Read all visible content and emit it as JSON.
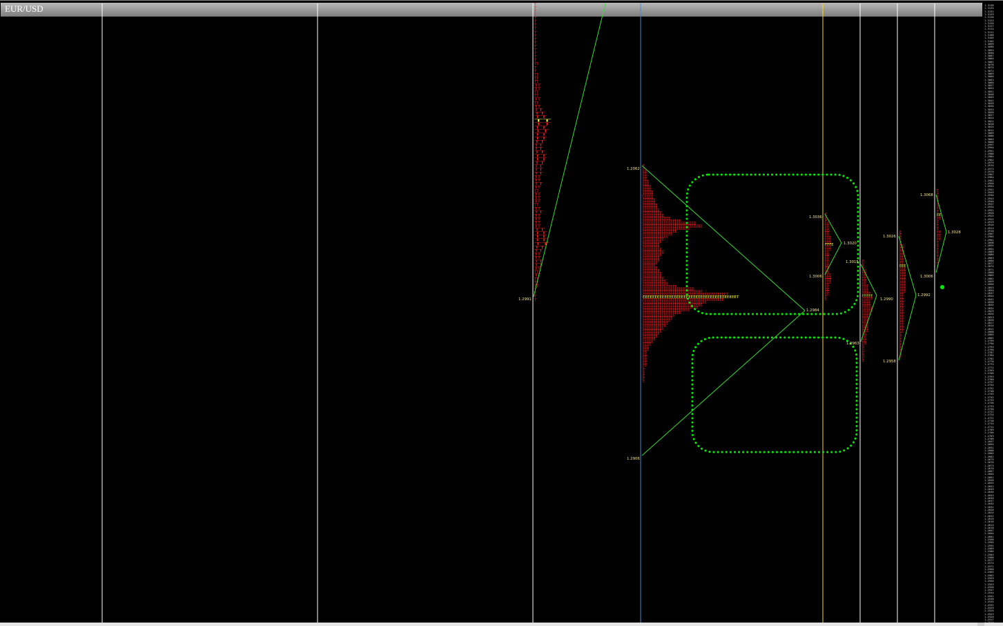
{
  "chart": {
    "symbol": "EUR/USD",
    "colors": {
      "background": "#000000",
      "session_divider": "#ffffff",
      "blue_marker": "#3c8ddc",
      "yellow_marker": "#ffd700",
      "tpo": "#ff1a1a",
      "poc": "#ffff33",
      "trend_line": "#33dd33",
      "highlight_box": "#00ee00",
      "level_label": "#f4e48a"
    }
  },
  "level_labels": [
    "1.2991",
    "1.2062",
    "1.2906",
    "1.2984",
    "1.3036",
    "1.3020",
    "1.3006",
    "1.3015",
    "1.2990",
    "1.2963",
    "1.3026",
    "1.3006",
    "1.2992",
    "1.2958",
    "1.3068",
    "1.3028"
  ],
  "price_scale": {
    "ticks": [
      "1.3138",
      "1.3135",
      "1.3132",
      "1.3129",
      "1.3126",
      "1.3123",
      "1.3120",
      "1.3117",
      "1.3114",
      "1.3111",
      "1.3108",
      "1.3105",
      "1.3102",
      "1.3099",
      "1.3096",
      "1.3093",
      "1.3090",
      "1.3087",
      "1.3084",
      "1.3081",
      "1.3078",
      "1.3075",
      "1.3072",
      "1.3069",
      "1.3066",
      "1.3063",
      "1.3060",
      "1.3057",
      "1.3054",
      "1.3051",
      "1.3048",
      "1.3045",
      "1.3042",
      "1.3039",
      "1.3036",
      "1.3033",
      "1.3030",
      "1.3027",
      "1.3024",
      "1.3021",
      "1.3018",
      "1.3015",
      "1.3012",
      "1.3009",
      "1.3006",
      "1.3003",
      "1.3000",
      "1.2997",
      "1.2994",
      "1.2991",
      "1.2988",
      "1.2985",
      "1.2982",
      "1.2979",
      "1.2976",
      "1.2973",
      "1.2970",
      "1.2967",
      "1.2964",
      "1.2961",
      "1.2958",
      "1.2955",
      "1.2952",
      "1.2949",
      "1.2946",
      "1.2943",
      "1.2940",
      "1.2937",
      "1.2934",
      "1.2931",
      "1.2928",
      "1.2925",
      "1.2922",
      "1.2919",
      "1.2916",
      "1.2913",
      "1.2910",
      "1.2907",
      "1.2904",
      "1.2901",
      "1.2898",
      "1.2895",
      "1.2892",
      "1.2889",
      "1.2886",
      "1.2883",
      "1.2880",
      "1.2877",
      "1.2874",
      "1.2871",
      "1.2868",
      "1.2865",
      "1.2862",
      "1.2859",
      "1.2856",
      "1.2853",
      "1.2850",
      "1.2847",
      "1.2844",
      "1.2841",
      "1.2838",
      "1.2835",
      "1.2832",
      "1.2829",
      "1.2826",
      "1.2823",
      "1.2820",
      "1.2817",
      "1.2814",
      "1.2811",
      "1.2808",
      "1.2805",
      "1.2802",
      "1.2799",
      "1.2796",
      "1.2793",
      "1.2790",
      "1.2787",
      "1.2784",
      "1.2781",
      "1.2778",
      "1.2775",
      "1.2772",
      "1.2769",
      "1.2766",
      "1.2763",
      "1.2760",
      "1.2757",
      "1.2754",
      "1.2751",
      "1.2748",
      "1.2745",
      "1.2742",
      "1.2739",
      "1.2736",
      "1.2733",
      "1.2730",
      "1.2727",
      "1.2724",
      "1.2721",
      "1.2718",
      "1.2715",
      "1.2712",
      "1.2709",
      "1.2706",
      "1.2703",
      "1.2700",
      "1.2697",
      "1.2694",
      "1.2691",
      "1.2688",
      "1.2685",
      "1.2682",
      "1.2679",
      "1.2676",
      "1.2673",
      "1.2670",
      "1.2667",
      "1.2664",
      "1.2661",
      "1.2658",
      "1.2655",
      "1.2652",
      "1.2649",
      "1.2646",
      "1.2643",
      "1.2640",
      "1.2637",
      "1.2634",
      "1.2631",
      "1.2628",
      "1.2625",
      "1.2622",
      "1.2619",
      "1.2616",
      "1.2613",
      "1.2610",
      "1.2607",
      "1.2604",
      "1.2601",
      "1.2598",
      "1.2595",
      "1.2592",
      "1.2589",
      "1.2586",
      "1.2583",
      "1.2580",
      "1.2577",
      "1.2574",
      "1.2571",
      "1.2568",
      "1.2565",
      "1.2562",
      "1.2559",
      "1.2556",
      "1.2553",
      "1.2550",
      "1.2547",
      "1.2544",
      "1.2541",
      "1.2538",
      "1.2535",
      "1.2532",
      "1.2529",
      "1.2526",
      "1.2523",
      "1.2520",
      "1.2517",
      "1.2514",
      "1.2511",
      "1.2508",
      "1.2505",
      "1.2502",
      "1.2499",
      "1.2496",
      "1.2493"
    ]
  },
  "profiles": [
    {
      "id": "session-4",
      "letters": "TT",
      "rows": [
        1,
        1,
        1,
        1,
        1,
        1,
        1,
        1,
        1,
        1,
        1,
        1,
        1,
        1,
        1,
        1,
        1,
        2,
        1,
        1,
        2,
        2,
        2,
        3,
        3,
        2,
        2,
        3,
        2,
        3,
        4,
        5,
        6,
        8,
        8,
        6,
        7,
        6,
        6,
        5,
        4,
        4,
        5,
        6,
        6,
        5,
        4,
        4,
        4,
        3,
        3,
        4,
        3,
        2,
        3,
        3,
        3,
        2,
        3,
        4,
        3,
        3,
        3,
        3,
        5,
        6,
        6,
        6,
        7,
        5,
        4,
        3,
        3,
        4,
        4,
        3,
        2,
        3,
        2,
        2,
        2,
        1,
        1,
        1,
        1
      ]
    },
    {
      "id": "session-5",
      "letters": "EEEEEEEEEEEEEEEEEEEEEEEEEEEEEEEEEEEEEEET",
      "rows": [
        1,
        1,
        2,
        2,
        2,
        2,
        3,
        3,
        4,
        4,
        5,
        5,
        5,
        6,
        6,
        7,
        7,
        8,
        9,
        10,
        13,
        18,
        25,
        28,
        22,
        16,
        14,
        12,
        10,
        9,
        8,
        8,
        9,
        10,
        9,
        8,
        8,
        7,
        6,
        7,
        8,
        9,
        9,
        10,
        11,
        12,
        16,
        24,
        28,
        40,
        45,
        38,
        30,
        28,
        26,
        22,
        18,
        15,
        14,
        13,
        12,
        11,
        10,
        9,
        8,
        7,
        6,
        5,
        4,
        3,
        3,
        2,
        2,
        2,
        2,
        2,
        2,
        1,
        1,
        1,
        1,
        1,
        1
      ]
    },
    {
      "id": "session-6",
      "letters": "EEEEEEEEEEEEEEEE",
      "rows": [
        1,
        1,
        1,
        1,
        2,
        2,
        2,
        2,
        2,
        2,
        3,
        3,
        3,
        4,
        3,
        3,
        2,
        2,
        2,
        2,
        2,
        2,
        2,
        2,
        2,
        2,
        3,
        3,
        3,
        3,
        2,
        2,
        2,
        2,
        2,
        1,
        1
      ]
    },
    {
      "id": "session-7",
      "letters": "EEEEEEEEEEEEEEEE",
      "rows": [
        1,
        1,
        1,
        1,
        2,
        2,
        2,
        2,
        2,
        2,
        3,
        3,
        3,
        4,
        5,
        5,
        4,
        4,
        4,
        5,
        5,
        4,
        3,
        3,
        3,
        3,
        3,
        3,
        3,
        2,
        2,
        2,
        2,
        2,
        1,
        1,
        1,
        1,
        1,
        1,
        1
      ]
    },
    {
      "id": "session-8",
      "letters": "EEEEEEEEEEEEEEEE",
      "rows": [
        1,
        1,
        1,
        1,
        1,
        2,
        2,
        2,
        2,
        2,
        2,
        2,
        3,
        3,
        3,
        3,
        3,
        3,
        3,
        3,
        3,
        3,
        2,
        2,
        2,
        2,
        2,
        2,
        2,
        2,
        2,
        2,
        2,
        2,
        2,
        2,
        1,
        1,
        1,
        1,
        1,
        1,
        1,
        1,
        1
      ]
    },
    {
      "id": "session-9",
      "letters": "EEEEEEEEEE",
      "rows": [
        1,
        1,
        1,
        1,
        1,
        1,
        1,
        2,
        2,
        1,
        1,
        1,
        2,
        2,
        2,
        1,
        1,
        1,
        1,
        1,
        1,
        1,
        1
      ]
    }
  ]
}
